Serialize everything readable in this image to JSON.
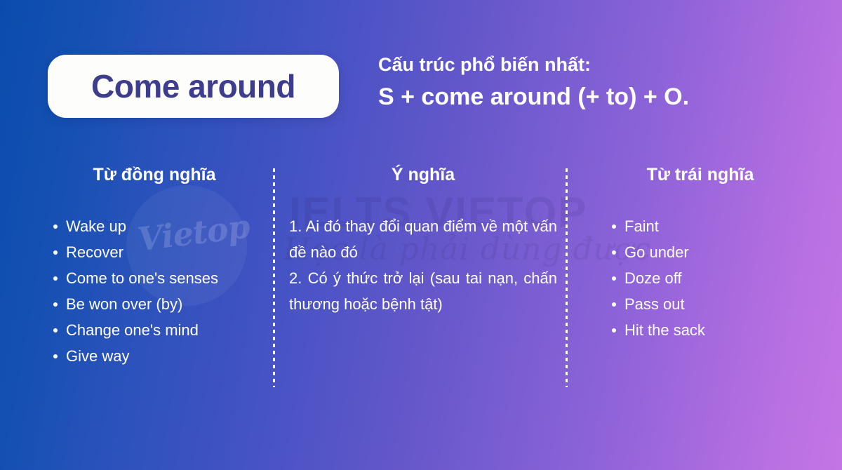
{
  "header": {
    "phrasal_verb": "Come around",
    "structure_label": "Cấu trúc phổ biến nhất:",
    "structure_formula": "S + come around (+ to) + O."
  },
  "columns": {
    "synonyms": {
      "heading": "Từ đồng nghĩa",
      "items": [
        "Wake up",
        "Recover",
        "Come to one's senses",
        "Be won over (by)",
        "Change one's mind",
        "Give way"
      ]
    },
    "meaning": {
      "heading": "Ý nghĩa",
      "lines": [
        "1. Ai đó thay đổi quan điểm về một vấn đề nào đó",
        "2. Có ý thức trở lại (sau tai nạn, chấn thương hoặc bệnh tật)"
      ]
    },
    "antonyms": {
      "heading": "Từ trái nghĩa",
      "items": [
        "Faint",
        "Go under",
        "Doze off",
        "Pass out",
        "Hit the sack"
      ]
    }
  },
  "watermark": {
    "logo_script": "Vietop",
    "brand_text": "IELTS VIETOP",
    "tagline": "Học là phải dùng được"
  },
  "colors": {
    "gradient_start": "#0a4cad",
    "gradient_end": "#c475e5",
    "pill_background": "#fdfdfb",
    "title_text": "#3d3c8d",
    "body_text": "#ffffff"
  }
}
